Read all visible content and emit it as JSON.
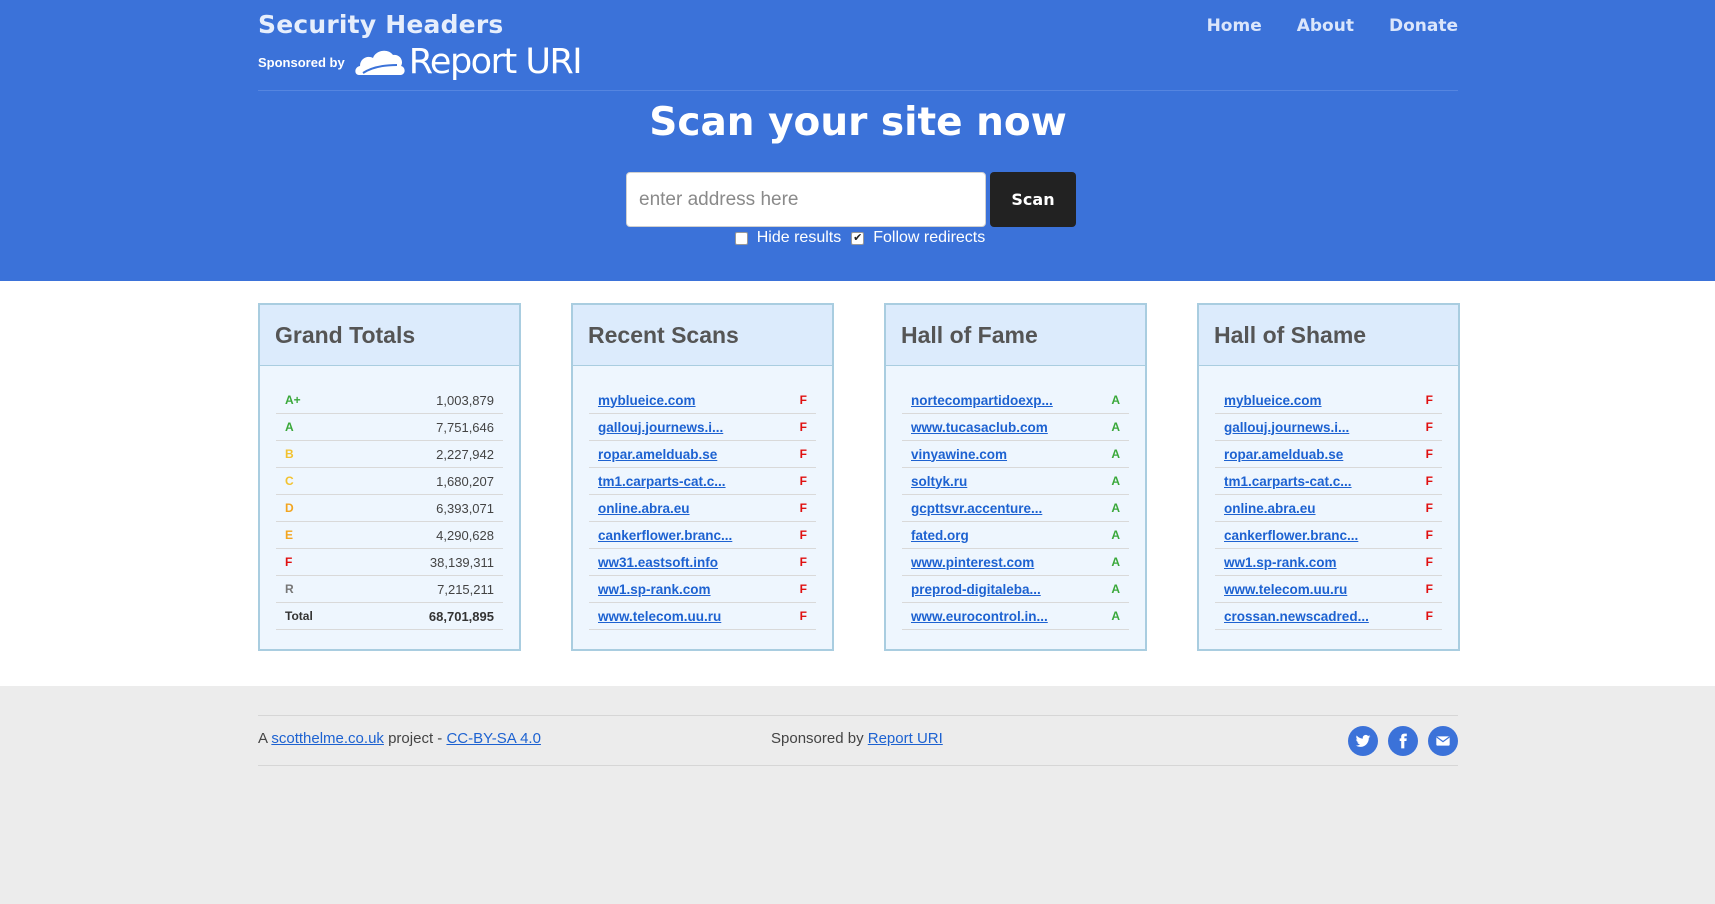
{
  "header": {
    "site_title": "Security Headers",
    "sponsored_by": "Sponsored by",
    "sponsor_logo_text": "Report URI",
    "nav": [
      {
        "label": "Home"
      },
      {
        "label": "About"
      },
      {
        "label": "Donate"
      }
    ]
  },
  "scan": {
    "heading": "Scan your site now",
    "input_placeholder": "enter address here",
    "input_value": "",
    "button_label": "Scan",
    "hide_results_label": "Hide results",
    "hide_results_checked": false,
    "follow_redirects_label": "Follow redirects",
    "follow_redirects_checked": true
  },
  "colors": {
    "brand_blue": "#3b72d9",
    "grade_a": "#3aa83a",
    "grade_b": "#f2c230",
    "grade_c": "#f2c230",
    "grade_d": "#f2a520",
    "grade_e": "#f2a520",
    "grade_f": "#e01010",
    "grade_r": "#777777"
  },
  "grand_totals": {
    "title": "Grand Totals",
    "rows": [
      {
        "grade": "A+",
        "count": "1,003,879",
        "color": "#3aa83a"
      },
      {
        "grade": "A",
        "count": "7,751,646",
        "color": "#3aa83a"
      },
      {
        "grade": "B",
        "count": "2,227,942",
        "color": "#f2c230"
      },
      {
        "grade": "C",
        "count": "1,680,207",
        "color": "#f2c230"
      },
      {
        "grade": "D",
        "count": "6,393,071",
        "color": "#f2a520"
      },
      {
        "grade": "E",
        "count": "4,290,628",
        "color": "#f2a520"
      },
      {
        "grade": "F",
        "count": "38,139,311",
        "color": "#e01010"
      },
      {
        "grade": "R",
        "count": "7,215,211",
        "color": "#777777"
      },
      {
        "grade": "Total",
        "count": "68,701,895",
        "color": "#333333"
      }
    ]
  },
  "recent_scans": {
    "title": "Recent Scans",
    "rows": [
      {
        "site": "myblueice.com",
        "grade": "F"
      },
      {
        "site": "gallouj.journews.i...",
        "grade": "F"
      },
      {
        "site": "ropar.amelduab.se",
        "grade": "F"
      },
      {
        "site": "tm1.carparts-cat.c...",
        "grade": "F"
      },
      {
        "site": "online.abra.eu",
        "grade": "F"
      },
      {
        "site": "cankerflower.branc...",
        "grade": "F"
      },
      {
        "site": "ww31.eastsoft.info",
        "grade": "F"
      },
      {
        "site": "ww1.sp-rank.com",
        "grade": "F"
      },
      {
        "site": "www.telecom.uu.ru",
        "grade": "F"
      }
    ]
  },
  "hall_of_fame": {
    "title": "Hall of Fame",
    "rows": [
      {
        "site": "nortecompartidoexp...",
        "grade": "A"
      },
      {
        "site": "www.tucasaclub.com",
        "grade": "A"
      },
      {
        "site": "vinyawine.com",
        "grade": "A"
      },
      {
        "site": "soltyk.ru",
        "grade": "A"
      },
      {
        "site": "gcpttsvr.accenture...",
        "grade": "A"
      },
      {
        "site": "fated.org",
        "grade": "A"
      },
      {
        "site": "www.pinterest.com",
        "grade": "A"
      },
      {
        "site": "preprod-digitaleba...",
        "grade": "A"
      },
      {
        "site": "www.eurocontrol.in...",
        "grade": "A"
      }
    ]
  },
  "hall_of_shame": {
    "title": "Hall of Shame",
    "rows": [
      {
        "site": "myblueice.com",
        "grade": "F"
      },
      {
        "site": "gallouj.journews.i...",
        "grade": "F"
      },
      {
        "site": "ropar.amelduab.se",
        "grade": "F"
      },
      {
        "site": "tm1.carparts-cat.c...",
        "grade": "F"
      },
      {
        "site": "online.abra.eu",
        "grade": "F"
      },
      {
        "site": "cankerflower.branc...",
        "grade": "F"
      },
      {
        "site": "ww1.sp-rank.com",
        "grade": "F"
      },
      {
        "site": "www.telecom.uu.ru",
        "grade": "F"
      },
      {
        "site": "crossan.newscadred...",
        "grade": "F"
      }
    ]
  },
  "footer": {
    "left_prefix": "A",
    "left_link": "scotthelme.co.uk",
    "left_middle": "project -",
    "license_link": "CC-BY-SA 4.0",
    "center_prefix": "Sponsored by",
    "center_link": "Report URI",
    "social": [
      {
        "icon": "twitter-icon"
      },
      {
        "icon": "facebook-icon"
      },
      {
        "icon": "email-icon"
      }
    ]
  }
}
